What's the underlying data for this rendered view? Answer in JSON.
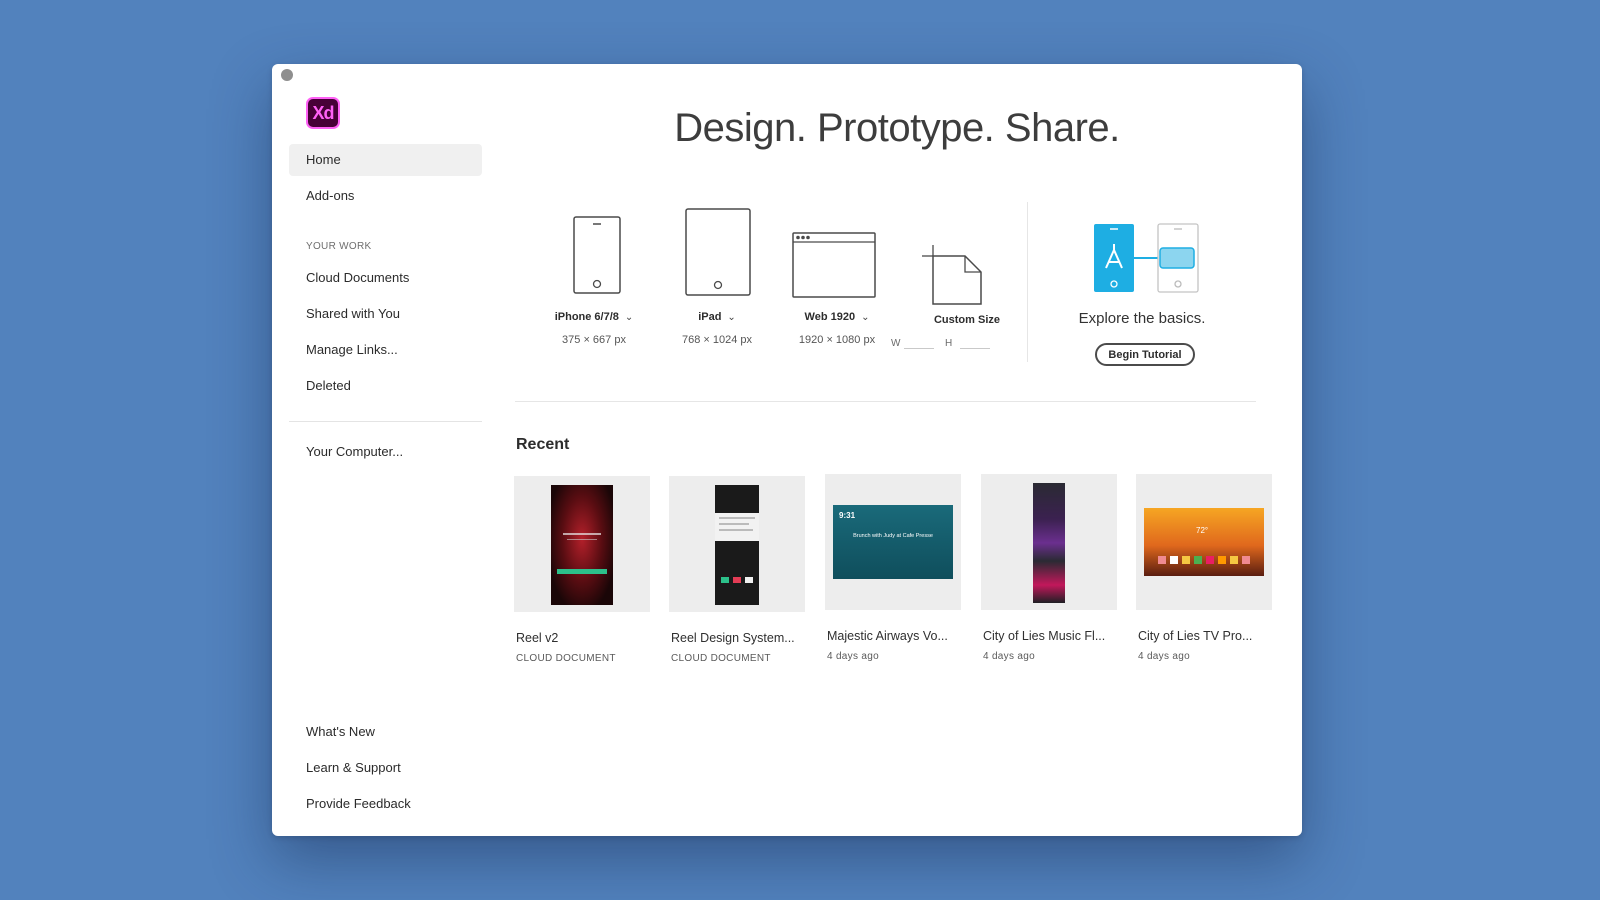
{
  "app": {
    "logo_text": "Xd"
  },
  "sidebar": {
    "items": [
      {
        "label": "Home"
      },
      {
        "label": "Add-ons"
      }
    ],
    "section_title": "YOUR WORK",
    "work_items": [
      {
        "label": "Cloud Documents"
      },
      {
        "label": "Shared with You"
      },
      {
        "label": "Manage Links..."
      },
      {
        "label": "Deleted"
      }
    ],
    "computer": {
      "label": "Your Computer..."
    },
    "footer_items": [
      {
        "label": "What's New"
      },
      {
        "label": "Learn & Support"
      },
      {
        "label": "Provide Feedback"
      }
    ]
  },
  "hero": {
    "title": "Design. Prototype. Share."
  },
  "presets": [
    {
      "name": "iPhone 6/7/8",
      "size": "375 × 667 px",
      "icon": "phone-icon"
    },
    {
      "name": "iPad",
      "size": "768 × 1024 px",
      "icon": "tablet-icon"
    },
    {
      "name": "Web 1920",
      "size": "1920 × 1080 px",
      "icon": "browser-icon"
    }
  ],
  "custom": {
    "name": "Custom Size",
    "w_label": "W",
    "h_label": "H"
  },
  "tutorial": {
    "text": "Explore the basics.",
    "button": "Begin Tutorial"
  },
  "recent": {
    "title": "Recent",
    "items": [
      {
        "title": "Reel v2",
        "sub": "CLOUD DOCUMENT"
      },
      {
        "title": "Reel Design System...",
        "sub": "CLOUD DOCUMENT"
      },
      {
        "title": "Majestic Airways Vo...",
        "sub": "4 days ago",
        "thumb_time": "9:31",
        "thumb_text": "Brunch with Judy at Cafe Presse"
      },
      {
        "title": "City of Lies Music Fl...",
        "sub": "4 days ago"
      },
      {
        "title": "City of Lies TV Pro...",
        "sub": "4 days ago",
        "thumb_temp": "72°"
      }
    ]
  },
  "colors": {
    "background": "#5282bd",
    "xd_pink": "#ff61f6",
    "xd_purple": "#470137",
    "tutorial_blue": "#1eaee3"
  }
}
